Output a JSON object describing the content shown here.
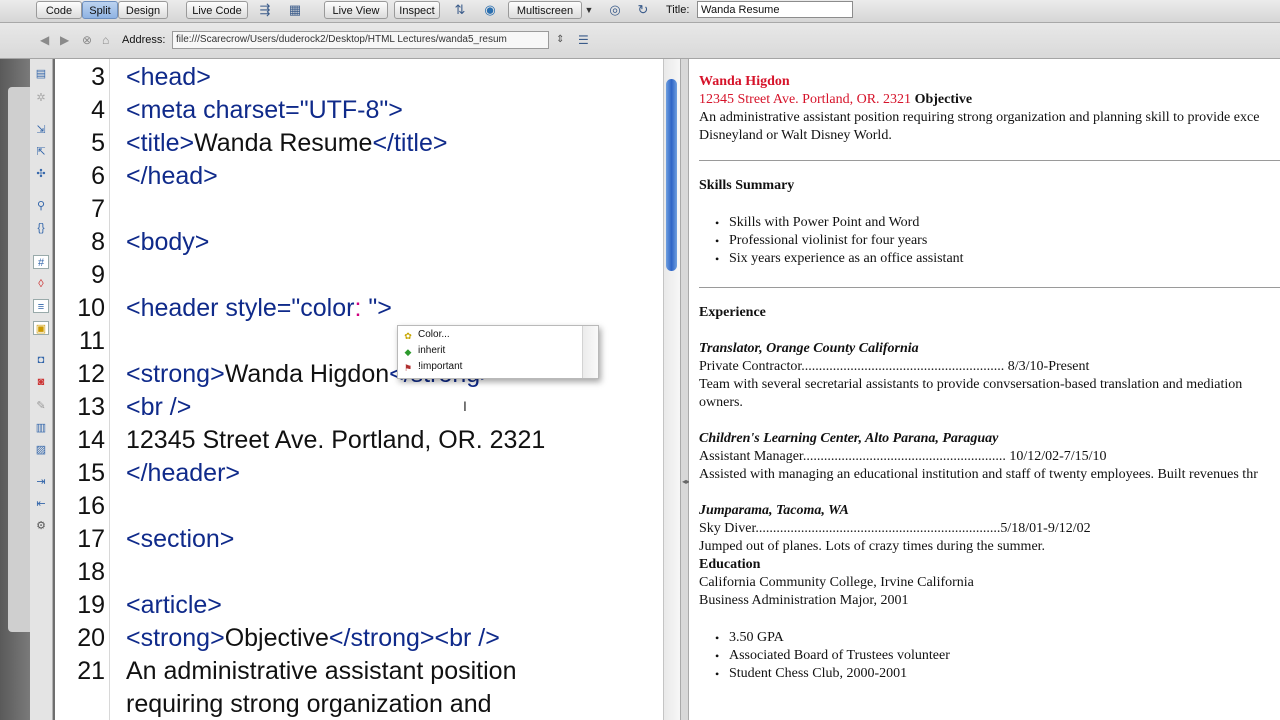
{
  "toolbar": {
    "view_code": "Code",
    "view_split": "Split",
    "view_design": "Design",
    "live_code": "Live Code",
    "live_view": "Live View",
    "inspect": "Inspect",
    "multiscreen": "Multiscreen",
    "title_label": "Title:",
    "title_value": "Wanda Resume"
  },
  "addressbar": {
    "label": "Address:",
    "value": "file:///Scarecrow/Users/duderock2/Desktop/HTML Lectures/wanda5_resum"
  },
  "editor": {
    "lines": [
      {
        "n": "3",
        "parts": [
          [
            "tag",
            "<head>"
          ]
        ]
      },
      {
        "n": "4",
        "parts": [
          [
            "tag",
            "<meta charset=\"UTF-8\">"
          ]
        ]
      },
      {
        "n": "5",
        "parts": [
          [
            "tag",
            "<title>"
          ],
          [
            "txt",
            "Wanda Resume"
          ],
          [
            "tag",
            "</title>"
          ]
        ]
      },
      {
        "n": "6",
        "parts": [
          [
            "tag",
            "</head>"
          ]
        ]
      },
      {
        "n": "7",
        "parts": []
      },
      {
        "n": "8",
        "parts": [
          [
            "tag",
            "<body>"
          ]
        ]
      },
      {
        "n": "9",
        "parts": []
      },
      {
        "n": "10",
        "parts": [
          [
            "tag",
            "<header style=\"color"
          ],
          [
            "caret",
            ":"
          ],
          [
            "tag",
            " \">"
          ]
        ]
      },
      {
        "n": "11",
        "parts": []
      },
      {
        "n": "12",
        "parts": [
          [
            "tag",
            "<strong>"
          ],
          [
            "txt",
            "Wanda Higdon"
          ],
          [
            "tag",
            "</strong>"
          ]
        ]
      },
      {
        "n": "13",
        "parts": [
          [
            "tag",
            "<br />"
          ]
        ]
      },
      {
        "n": "14",
        "parts": [
          [
            "txt",
            "12345 Street Ave. Portland, OR. 2321"
          ]
        ]
      },
      {
        "n": "15",
        "parts": [
          [
            "tag",
            "</header>"
          ]
        ]
      },
      {
        "n": "16",
        "parts": []
      },
      {
        "n": "17",
        "parts": [
          [
            "tag",
            "<section>"
          ]
        ]
      },
      {
        "n": "18",
        "parts": []
      },
      {
        "n": "19",
        "parts": [
          [
            "tag",
            "<article>"
          ]
        ]
      },
      {
        "n": "20",
        "parts": [
          [
            "tag",
            "<strong>"
          ],
          [
            "txt",
            "Objective"
          ],
          [
            "tag",
            "</strong><br />"
          ]
        ]
      },
      {
        "n": "21",
        "parts": [
          [
            "txt",
            "An administrative assistant position"
          ]
        ]
      },
      {
        "n": "",
        "parts": [
          [
            "txt",
            "requiring strong organization and"
          ]
        ]
      }
    ]
  },
  "autocomplete": {
    "items": [
      {
        "label": "Color...",
        "icon": "color-wheel-icon"
      },
      {
        "label": "inherit",
        "icon": "value-tag-icon"
      },
      {
        "label": "!important",
        "icon": "flag-icon"
      }
    ]
  },
  "design_view": {
    "name": "Wanda Higdon",
    "address": "12345 Street Ave. Portland, OR. 2321",
    "objective_heading": "Objective",
    "objective_line1": "An administrative assistant position requiring strong organization and planning skill to provide exce",
    "objective_line2": "Disneyland or Walt Disney World.",
    "skills_heading": "Skills Summary",
    "skills": [
      "Skills with Power Point and Word",
      "Professional violinist for four years",
      "Six years experience as an office assistant"
    ],
    "experience_heading": "Experience",
    "jobs": [
      {
        "title": "Translator, Orange County California",
        "role": "Private Contractor.......................................................... 8/3/10-Present",
        "desc1": "Team with several secretarial assistants to provide convsersation-based translation and mediation",
        "desc2": "owners."
      },
      {
        "title": "Children's Learning Center, Alto Parana, Paraguay",
        "role": "Assistant Manager.......................................................... 10/12/02-7/15/10",
        "desc1": "Assisted with managing an educational institution and staff of twenty employees. Built revenues thr",
        "desc2": ""
      },
      {
        "title": "Jumparama, Tacoma, WA",
        "role": "Sky Diver......................................................................5/18/01-9/12/02",
        "desc1": "Jumped out of planes. Lots of crazy times during the summer.",
        "desc2": ""
      }
    ],
    "education_heading": "Education",
    "education_school": "California Community College, Irvine California",
    "education_major": "Business Administration Major, 2001",
    "education_items": [
      "3.50 GPA",
      "Associated Board of Trustees volunteer",
      "Student Chess Club, 2000-2001"
    ]
  }
}
